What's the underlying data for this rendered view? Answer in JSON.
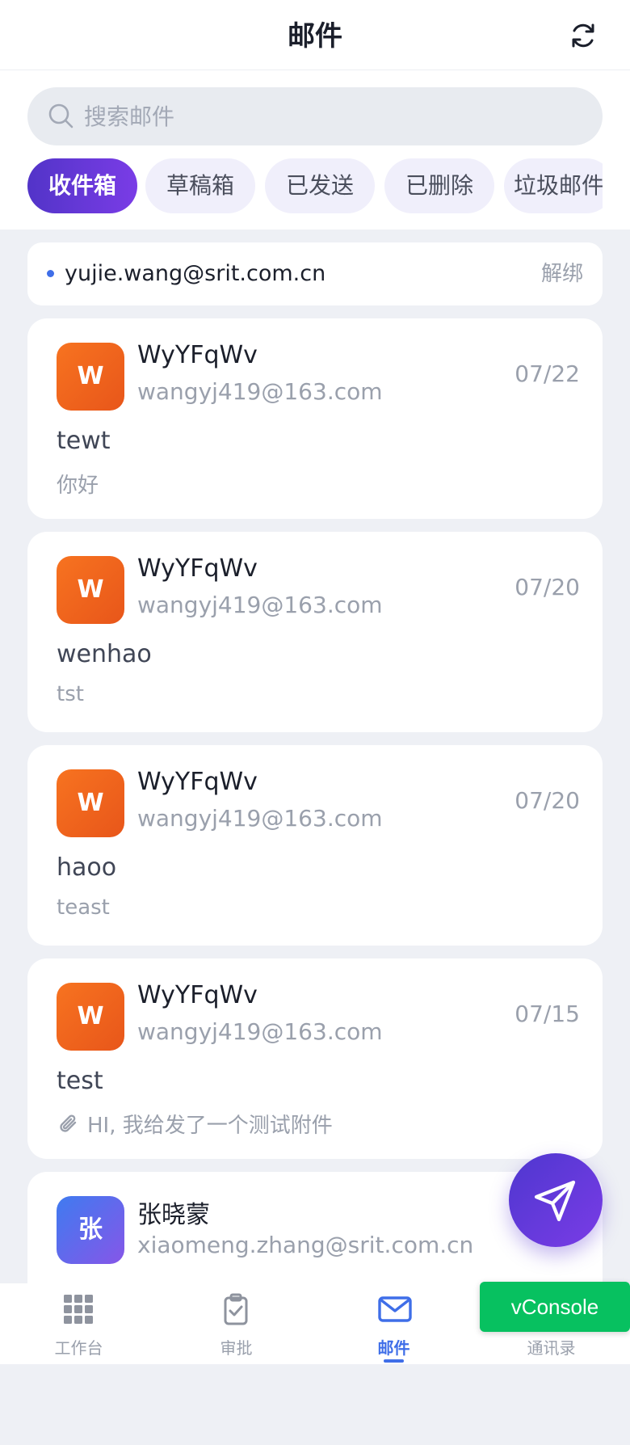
{
  "header": {
    "title": "邮件",
    "refresh_icon": "refresh-icon"
  },
  "search": {
    "placeholder": "搜索邮件"
  },
  "tabs": [
    {
      "label": "收件箱",
      "active": true
    },
    {
      "label": "草稿箱"
    },
    {
      "label": "已发送"
    },
    {
      "label": "已删除"
    },
    {
      "label": "垃圾邮件"
    }
  ],
  "account": {
    "email": "yujie.wang@srit.com.cn",
    "unbind": "解绑"
  },
  "mails": [
    {
      "avatar": "W",
      "sender": "WyYFqWv",
      "address": "wangyj419@163.com",
      "date": "07/22",
      "subject": "tewt",
      "preview": "你好",
      "attachment": false
    },
    {
      "avatar": "W",
      "sender": "WyYFqWv",
      "address": "wangyj419@163.com",
      "date": "07/20",
      "subject": "wenhao",
      "preview": "tst",
      "attachment": false
    },
    {
      "avatar": "W",
      "sender": "WyYFqWv",
      "address": "wangyj419@163.com",
      "date": "07/20",
      "subject": "haoo",
      "preview": "teast",
      "attachment": false
    },
    {
      "avatar": "W",
      "sender": "WyYFqWv",
      "address": "wangyj419@163.com",
      "date": "07/15",
      "subject": "test",
      "preview": "HI, 我给发了一个测试附件",
      "attachment": true
    },
    {
      "avatar": "张",
      "sender": "张晓蒙",
      "address": "xiaomeng.zhang@srit.com.cn"
    }
  ],
  "nav": [
    {
      "label": "工作台"
    },
    {
      "label": "审批"
    },
    {
      "label": "邮件",
      "active": true
    },
    {
      "label": "通讯录"
    }
  ],
  "vconsole": "vConsole",
  "colors": {
    "accent": "#5234c8",
    "nav_active": "#3f6ee8",
    "avatar_orange": "#f26a1b",
    "vconsole_green": "#07c160"
  }
}
